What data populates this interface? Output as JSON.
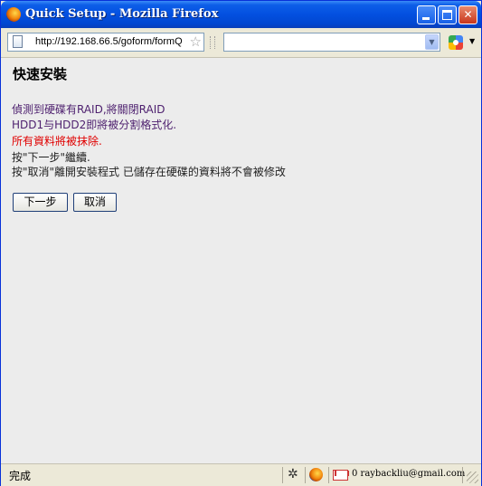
{
  "window": {
    "title": "Quick Setup - Mozilla Firefox"
  },
  "navbar": {
    "url": "http://192.168.66.5/goform/formQ",
    "search_value": ""
  },
  "page": {
    "title": "快速安裝",
    "message_line1": "偵測到硬碟有RAID,將關閉RAID",
    "message_line2": "HDD1与HDD2即將被分割格式化.",
    "warning": "所有資料將被抹除.",
    "instruction_next": "按\"下一步\"繼續.",
    "instruction_cancel": "按\"取消\"離開安裝程式 已儲存在硬碟的資料將不會被修改",
    "next_button": "下一步",
    "cancel_button": "取消"
  },
  "statusbar": {
    "status": "完成",
    "gmail": "0 raybackliu@gmail.com"
  }
}
